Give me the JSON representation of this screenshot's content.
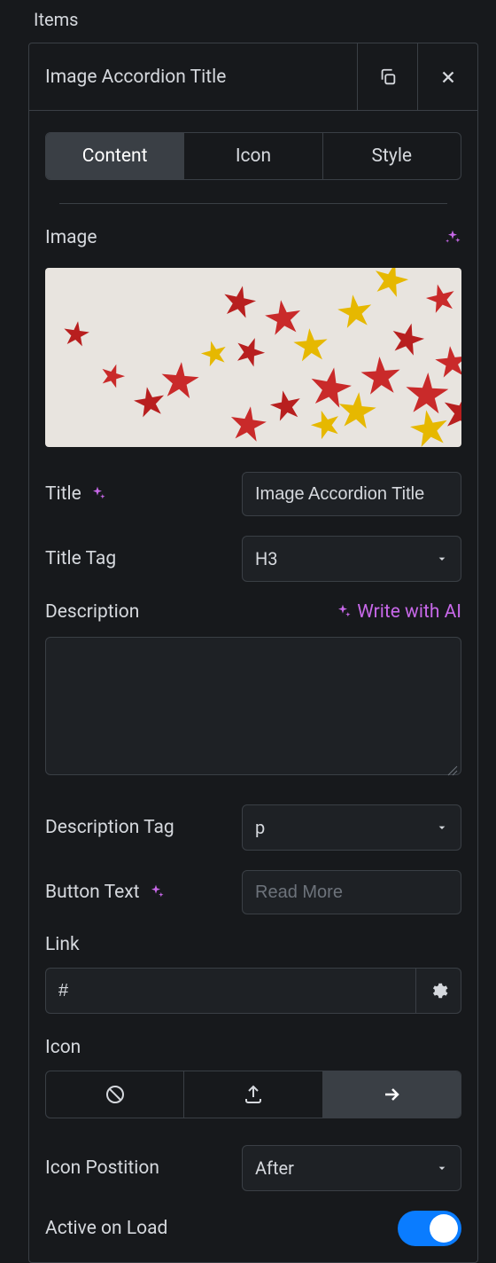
{
  "section": {
    "title": "Items"
  },
  "header": {
    "title": "Image Accordion Title"
  },
  "tabs": {
    "content": "Content",
    "icon": "Icon",
    "style": "Style"
  },
  "fields": {
    "image_label": "Image",
    "title_label": "Title",
    "title_value": "Image Accordion Title",
    "title_tag_label": "Title Tag",
    "title_tag_value": "H3",
    "description_label": "Description",
    "write_with_ai": "Write with AI",
    "description_value": "",
    "description_tag_label": "Description Tag",
    "description_tag_value": "p",
    "button_text_label": "Button Text",
    "button_text_placeholder": "Read More",
    "button_text_value": "",
    "link_label": "Link",
    "link_value": "#",
    "icon_label": "Icon",
    "icon_position_label": "Icon Postition",
    "icon_position_value": "After",
    "active_on_load_label": "Active on Load",
    "active_on_load_value": true
  },
  "icon_segments": {
    "none": "none-icon",
    "upload": "upload-icon",
    "arrow": "arrow-right-icon",
    "selected": "arrow"
  }
}
